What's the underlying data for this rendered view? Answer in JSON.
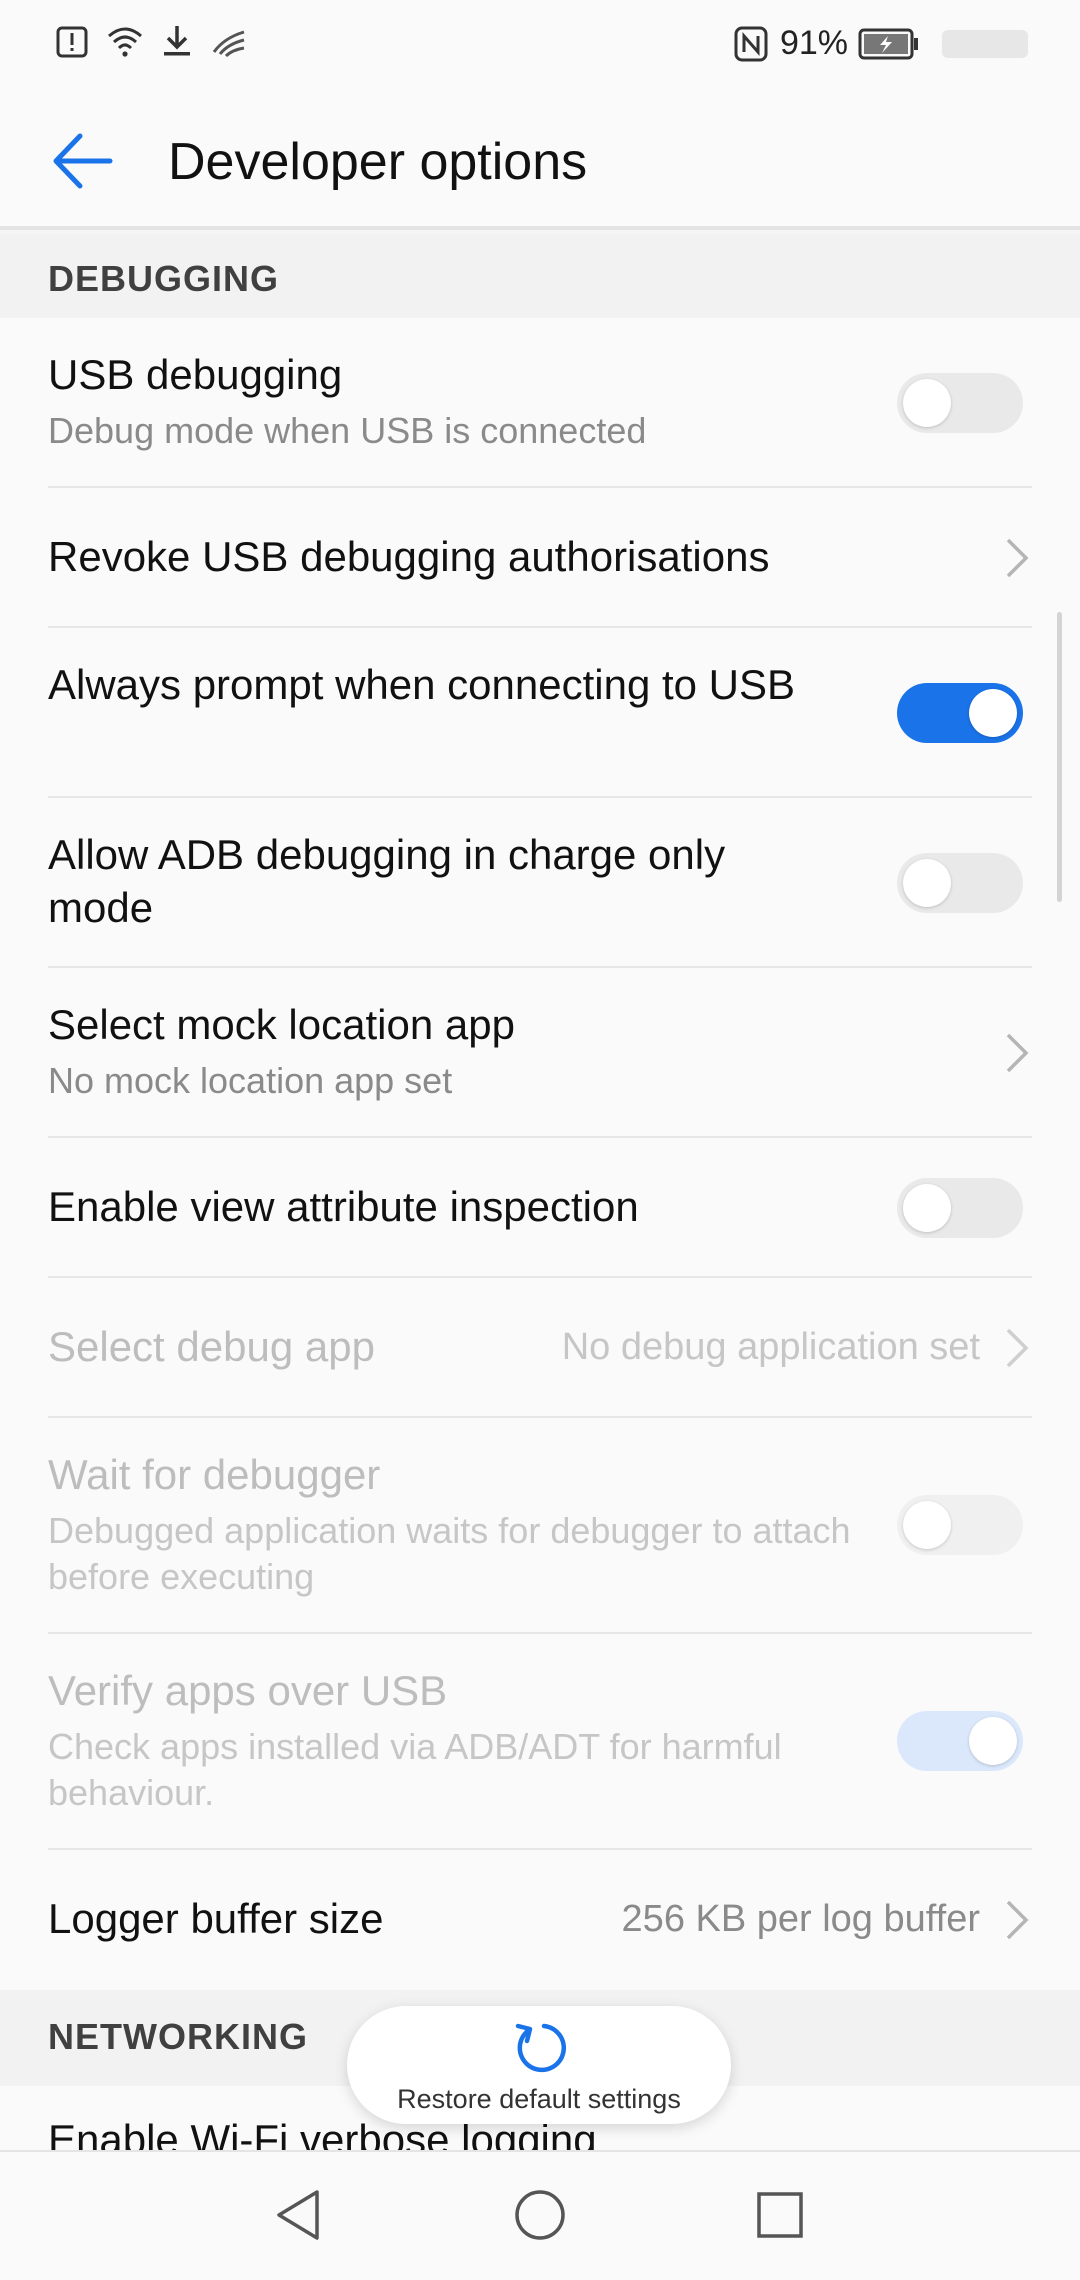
{
  "status_bar": {
    "battery_percent": "91%",
    "icons": [
      "alert-icon",
      "wifi-icon",
      "download-icon",
      "signal-icon",
      "nfc-icon",
      "battery-charging-icon"
    ]
  },
  "app_bar": {
    "title": "Developer options",
    "back_icon": "back-arrow-icon"
  },
  "sections": {
    "debugging": "DEBUGGING",
    "networking": "NETWORKING"
  },
  "items": [
    {
      "title": "USB debugging",
      "subtitle": "Debug mode when USB is connected",
      "control": "toggle",
      "on": false,
      "disabled": false
    },
    {
      "title": "Revoke USB debugging authorisations",
      "control": "chevron",
      "disabled": false
    },
    {
      "title": "Always prompt when connecting to USB",
      "control": "toggle",
      "on": true,
      "disabled": false
    },
    {
      "title": "Allow ADB debugging in charge only mode",
      "control": "toggle",
      "on": false,
      "disabled": false
    },
    {
      "title": "Select mock location app",
      "subtitle": "No mock location app set",
      "control": "chevron",
      "disabled": false
    },
    {
      "title": "Enable view attribute inspection",
      "control": "toggle",
      "on": false,
      "disabled": false
    },
    {
      "title": "Select debug app",
      "value": "No debug application set",
      "control": "chevron",
      "disabled": true
    },
    {
      "title": "Wait for debugger",
      "subtitle": "Debugged application waits for debugger to attach before executing",
      "control": "toggle",
      "on": false,
      "disabled": true
    },
    {
      "title": "Verify apps over USB",
      "subtitle": "Check apps installed via ADB/ADT for harmful behaviour.",
      "control": "toggle",
      "on": true,
      "disabled": true
    },
    {
      "title": "Logger buffer size",
      "value": "256 KB per log buffer",
      "control": "chevron",
      "disabled": false
    }
  ],
  "networking_items": [
    {
      "title": "Enable Wi-Fi verbose logging"
    }
  ],
  "restore_button": {
    "label": "Restore default settings",
    "icon": "restore-icon"
  },
  "nav_bar": {
    "icons": [
      "nav-back-icon",
      "nav-home-icon",
      "nav-recents-icon"
    ]
  },
  "colors": {
    "accent": "#1a73e8",
    "toggle_off": "#e9e9e9",
    "section_bg": "#f2f2f2"
  }
}
